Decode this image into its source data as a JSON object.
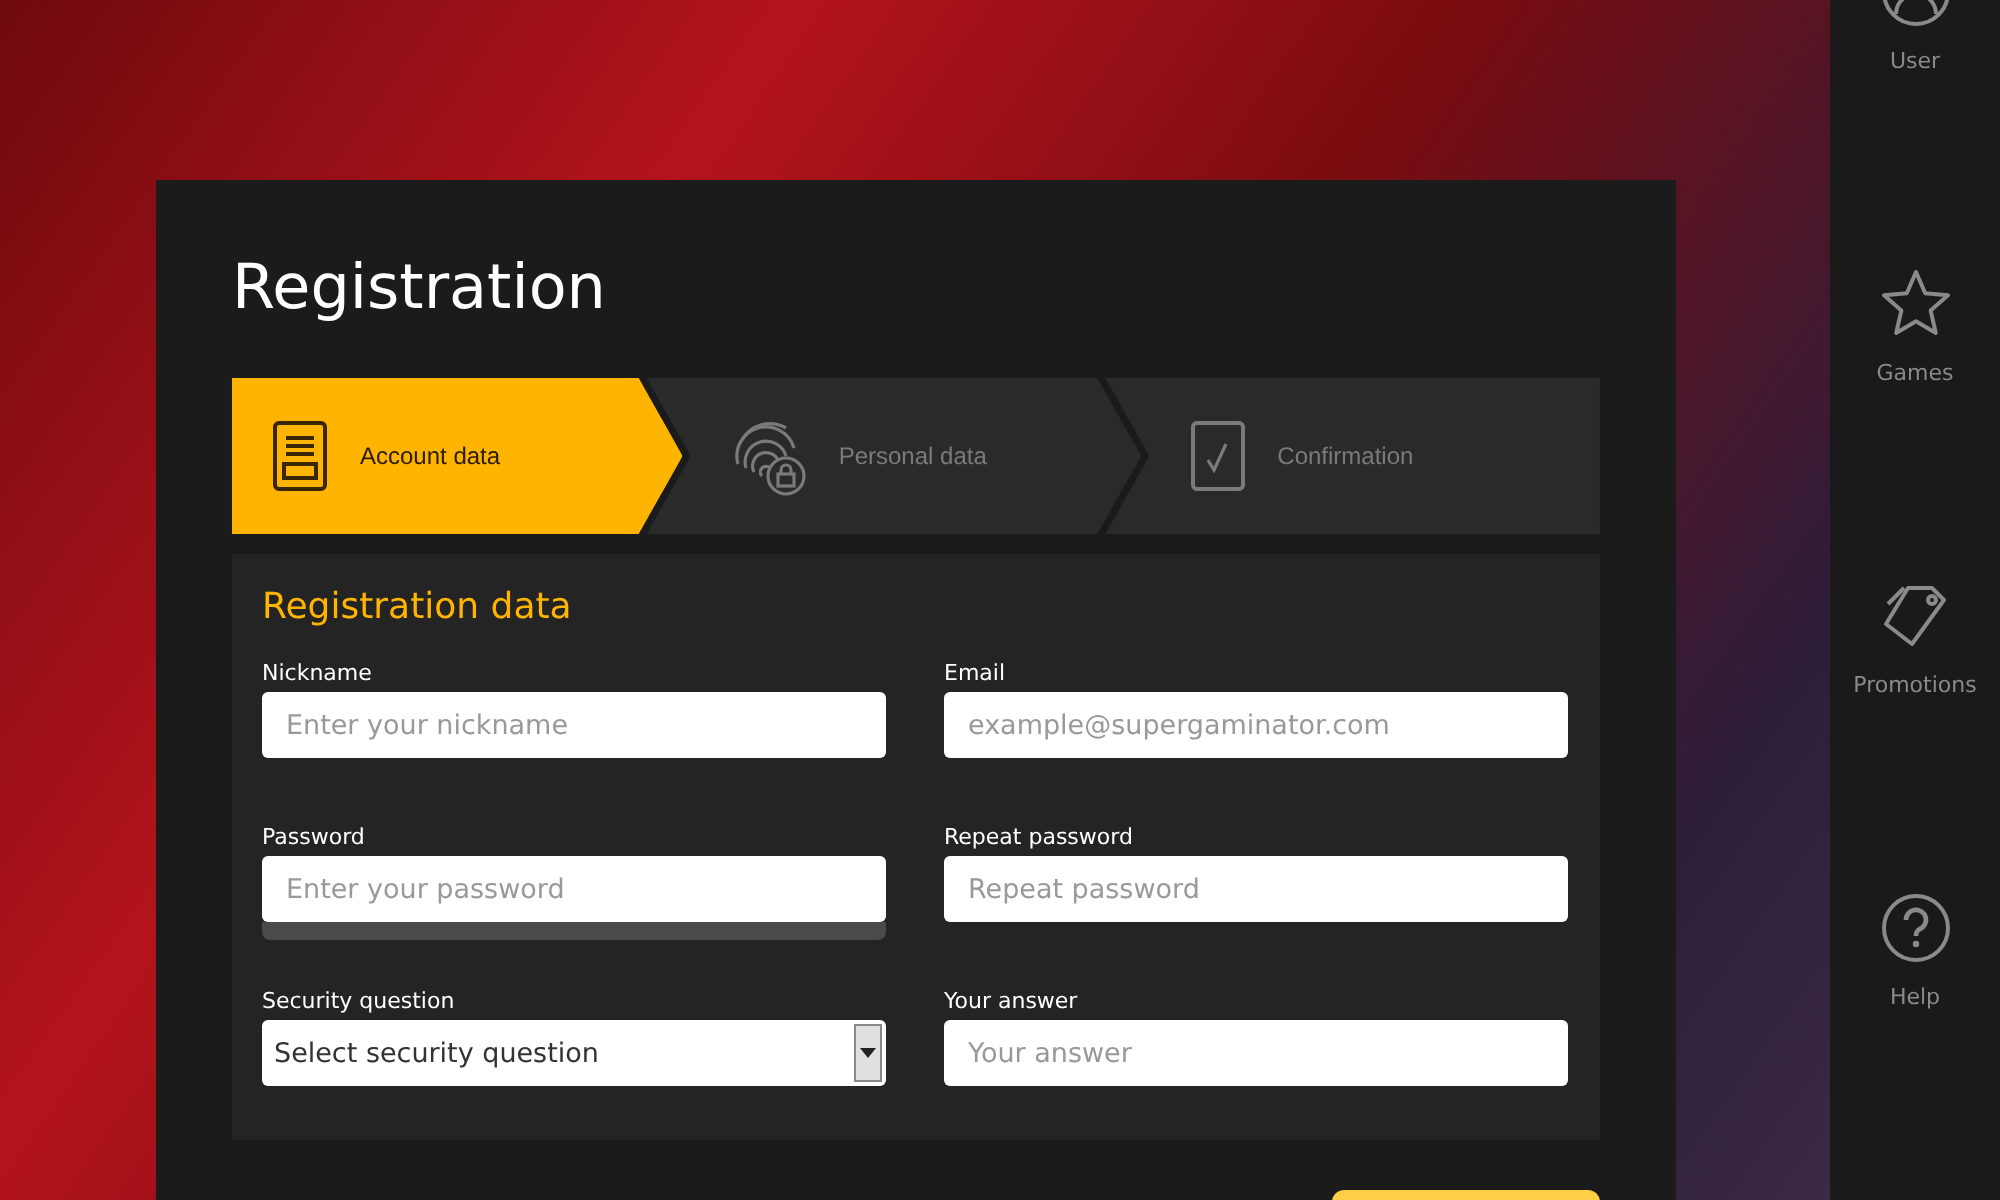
{
  "registration": {
    "title": "Registration",
    "steps": [
      {
        "label": "Account data",
        "kind": "document",
        "selected": true
      },
      {
        "label": "Personal data",
        "kind": "fingerprint",
        "selected": false
      },
      {
        "label": "Confirmation",
        "kind": "check",
        "selected": false
      }
    ],
    "section_title": "Registration data",
    "fields": [
      {
        "label": "Nickname",
        "kind": "text",
        "placeholder": "Enter your nickname"
      },
      {
        "label": "Email",
        "kind": "text",
        "placeholder": "example@supergaminator.com"
      },
      {
        "label": "Password",
        "kind": "password",
        "placeholder": "Enter your password",
        "strength": {
          "level": 0
        }
      },
      {
        "label": "Repeat password",
        "kind": "text",
        "placeholder": "Repeat password"
      },
      {
        "label": "Security question",
        "kind": "select",
        "value": "Select security question"
      },
      {
        "label": "Your answer",
        "kind": "text",
        "placeholder": "Your answer"
      }
    ]
  },
  "sidebar": {
    "items": [
      {
        "label": "User",
        "kind": "user"
      },
      {
        "label": "Games",
        "kind": "star"
      },
      {
        "label": "Promotions",
        "kind": "tag"
      },
      {
        "label": "Help",
        "kind": "help"
      }
    ]
  }
}
